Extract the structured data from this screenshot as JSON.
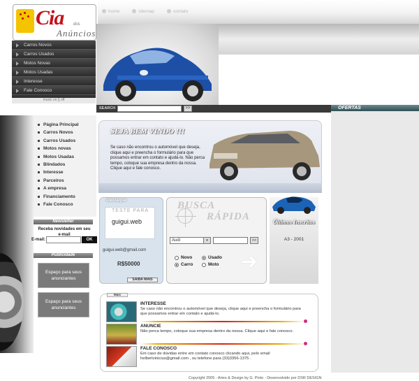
{
  "logo": {
    "name": "Cia",
    "small": "dos",
    "sub": "Anúncios"
  },
  "topnav": [
    {
      "label": "home"
    },
    {
      "label": "sitemap"
    },
    {
      "label": "contato"
    }
  ],
  "leftmenu": [
    "Carros Novos",
    "Carros Usados",
    "Motos Novas",
    "Motos Usadas",
    "Interesse",
    "Fale Conosco"
  ],
  "music": "music  on  ||  off",
  "search": {
    "label": "SEARCH",
    "button": ">>"
  },
  "ofertas": "OFERTAS",
  "nav": [
    "Página Principal",
    "Carros Novos",
    "Carros Usados",
    "Motos novas",
    "Motos Usadas",
    "Blindados",
    "Interesse",
    "Parceiros",
    "A empresa",
    "Financiamento",
    "Fale Conosco"
  ],
  "newsletter": {
    "title": "Newsletter",
    "text": "Receba novidades em seu e-mail",
    "email_label": "E-mail:",
    "button": "OK"
  },
  "publicidade": {
    "title": "Publicidade",
    "ad1": "Espaço para seus anunciantes",
    "ad2": "Espaço para seus anunciantes"
  },
  "welcome": {
    "title": "SEJA BEM VINDO !!!",
    "text": "Se caso não encontrou o automóvel que deseja, clique aqui e preencha o formulário para que possamos entrar em contato e ajudá-lo. Não perca tempo, coloque sua empresa dentro da nossa. Clique aqui e fale conosco."
  },
  "destaque": {
    "title": "Destaque",
    "teste": "TESTE PARA",
    "logo": "guigui.web",
    "email": "guigui.web@gmail.com",
    "price": "R$50000",
    "button": "SAIBA MAIS"
  },
  "busca": {
    "title1": "BUSCA",
    "title2": "RÁPIDA",
    "brand": "Audi",
    "brand_arrow": "▾",
    "button": ">>",
    "novo": "Novo",
    "usado": "Usado",
    "carro": "Carro",
    "moto": "Moto"
  },
  "ultimos": {
    "title": "Últimos Inscritos",
    "item": "A3 - 2001"
  },
  "mais": {
    "title": "Mais",
    "items": [
      {
        "heading": "INTERESSE",
        "text": "Se caso não encontrou o automóvel que deseja, clique aqui e preencha o formulário para que possamos entrar em contato e ajudá-lo."
      },
      {
        "heading": "ANUNCIE",
        "text": "Não perca tempo, coloque sua empresa dentro da nossa. Clique aqui e fale conosco."
      },
      {
        "heading": "FALE CONOSCO",
        "text": "Em caso de dúvidas entre em contato conosco clicando aqui, pelo email helbertvinicius@gmail.com , ou telefone para (33)3356-1375 ."
      }
    ]
  },
  "footer": "Copyright 2005 - Artes & Design by G. Pinto - Desenvolvido por DSR DESIGN"
}
